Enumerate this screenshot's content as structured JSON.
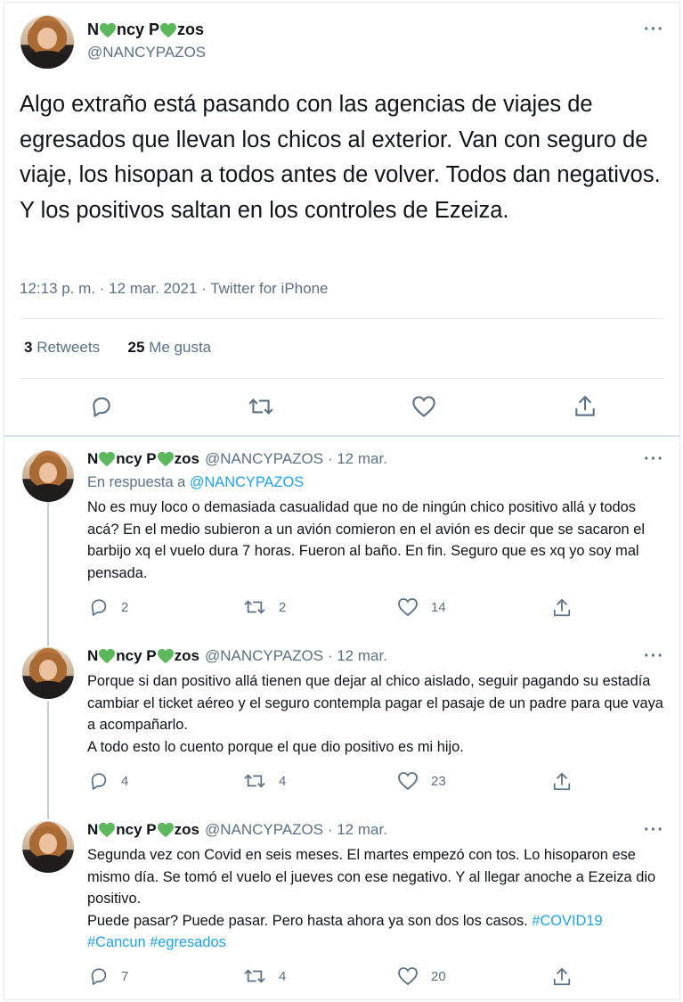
{
  "main_tweet": {
    "name_parts": [
      "N",
      "ncy P",
      "zos"
    ],
    "handle": "@NANCYPAZOS",
    "text": "Algo extraño está pasando con las agencias de viajes de egresados que llevan los chicos al exterior. Van con seguro de viaje, los hisopan a todos antes de volver. Todos dan negativos. Y los positivos saltan en los controles de Ezeiza.",
    "timestamp": "12:13 p. m. · 12 mar. 2021 · Twitter for iPhone",
    "retweets_count": "3",
    "retweets_label": "Retweets",
    "likes_count": "25",
    "likes_label": "Me gusta",
    "more_label": "···"
  },
  "replies": [
    {
      "name_parts": [
        "N",
        "ncy P",
        "zos"
      ],
      "handle_date": "@NANCYPAZOS · 12 mar.",
      "replying_prefix": "En respuesta a",
      "replying_handle": "@NANCYPAZOS",
      "text": "No es muy loco o demasiada casualidad que no de ningún chico positivo allá y todos acá? En el medio subieron a un avión comieron en el avión es decir que se sacaron el barbijo xq el vuelo dura 7 horas. Fueron al baño. En fin. Seguro que es xq yo soy mal pensada.",
      "replies": "2",
      "retweets": "2",
      "likes": "14"
    },
    {
      "name_parts": [
        "N",
        "ncy P",
        "zos"
      ],
      "handle_date": "@NANCYPAZOS · 12 mar.",
      "text": "Porque si dan positivo allá tienen que dejar al chico aislado, seguir pagando su estadía cambiar el ticket aéreo y el seguro contempla pagar el pasaje de un padre para que vaya a acompañarlo.\nA todo esto lo cuento porque el que dio positivo es mi hijo.",
      "replies": "4",
      "retweets": "4",
      "likes": "23"
    },
    {
      "name_parts": [
        "N",
        "ncy P",
        "zos"
      ],
      "handle_date": "@NANCYPAZOS · 12 mar.",
      "text": "Segunda vez con Covid en seis meses. El martes empezó con tos. Lo hisoparon ese mismo día. Se tomó el vuelo el jueves con ese negativo. Y al llegar anoche a Ezeiza dio positivo.\nPuede pasar? Puede pasar. Pero hasta ahora ya son dos los casos.",
      "hashtag1": "#COVID19",
      "hashtag2": "#Cancun",
      "hashtag3": "#egresados",
      "replies": "7",
      "retweets": "4",
      "likes": "20"
    }
  ],
  "colors": {
    "heart": "#5cb85c",
    "link": "#1da1f2",
    "muted": "#5b7083"
  }
}
